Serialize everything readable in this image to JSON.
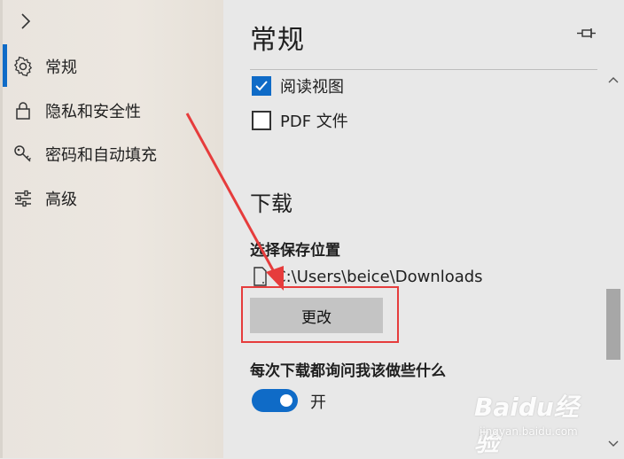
{
  "sidebar": {
    "items": [
      {
        "label": "常规",
        "icon": "gear-icon"
      },
      {
        "label": "隐私和安全性",
        "icon": "lock-icon"
      },
      {
        "label": "密码和自动填充",
        "icon": "key-icon"
      },
      {
        "label": "高级",
        "icon": "sliders-icon"
      }
    ],
    "accent_color": "#0f6bc7"
  },
  "panel": {
    "title": "常规",
    "checkboxes": [
      {
        "label": "阅读视图",
        "checked": true
      },
      {
        "label": "PDF 文件",
        "checked": false
      }
    ],
    "downloads": {
      "heading": "下载",
      "location_label": "选择保存位置",
      "path": "C:\\Users\\beice\\Downloads",
      "change_button": "更改",
      "ask_label": "每次下载都询问我该做些什么",
      "toggle_state": "开",
      "toggle_on": true
    }
  },
  "annotation": {
    "highlight_color": "#e63c3c"
  },
  "watermark": {
    "brand": "Baidu经验",
    "url": "jingyan.baidu.com"
  }
}
